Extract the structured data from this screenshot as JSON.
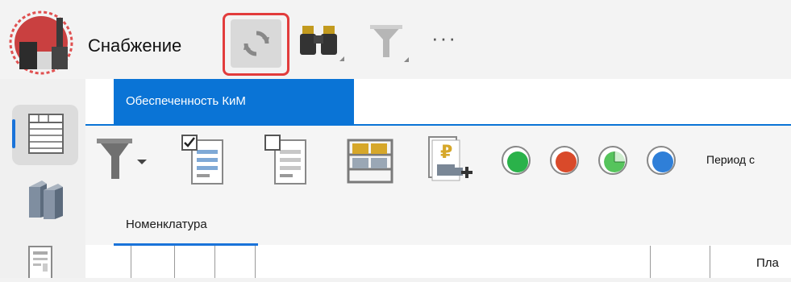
{
  "app": {
    "title": "Снабжение",
    "more": "···"
  },
  "document_tab": {
    "label": "Обеспеченность КиМ"
  },
  "subtab": {
    "label": "Номенклатура"
  },
  "toolbar": {
    "period_label": "Период с"
  },
  "grid": {
    "partial_header": "Пла"
  },
  "colors": {
    "accent": "#0a74d6",
    "highlight_border": "#e23c3c",
    "status_green": "#2ab24a",
    "status_red": "#d94a2a",
    "status_pie": "#56c45c",
    "status_blue": "#2f7fd8"
  }
}
